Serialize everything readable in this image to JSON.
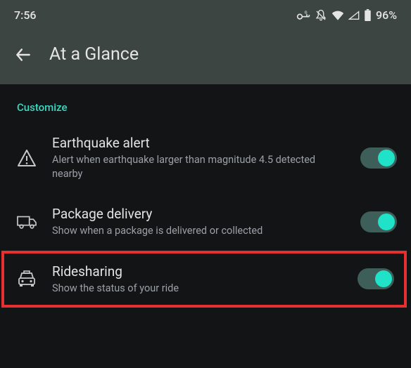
{
  "statusBar": {
    "time": "7:56",
    "battery": "96%"
  },
  "header": {
    "title": "At a Glance"
  },
  "sectionLabel": "Customize",
  "settings": [
    {
      "title": "Earthquake alert",
      "desc": "Alert when earthquake larger than magnitude 4.5 detected nearby"
    },
    {
      "title": "Package delivery",
      "desc": "Show when a package is delivered or collected"
    },
    {
      "title": "Ridesharing",
      "desc": "Show the status of your ride"
    }
  ]
}
